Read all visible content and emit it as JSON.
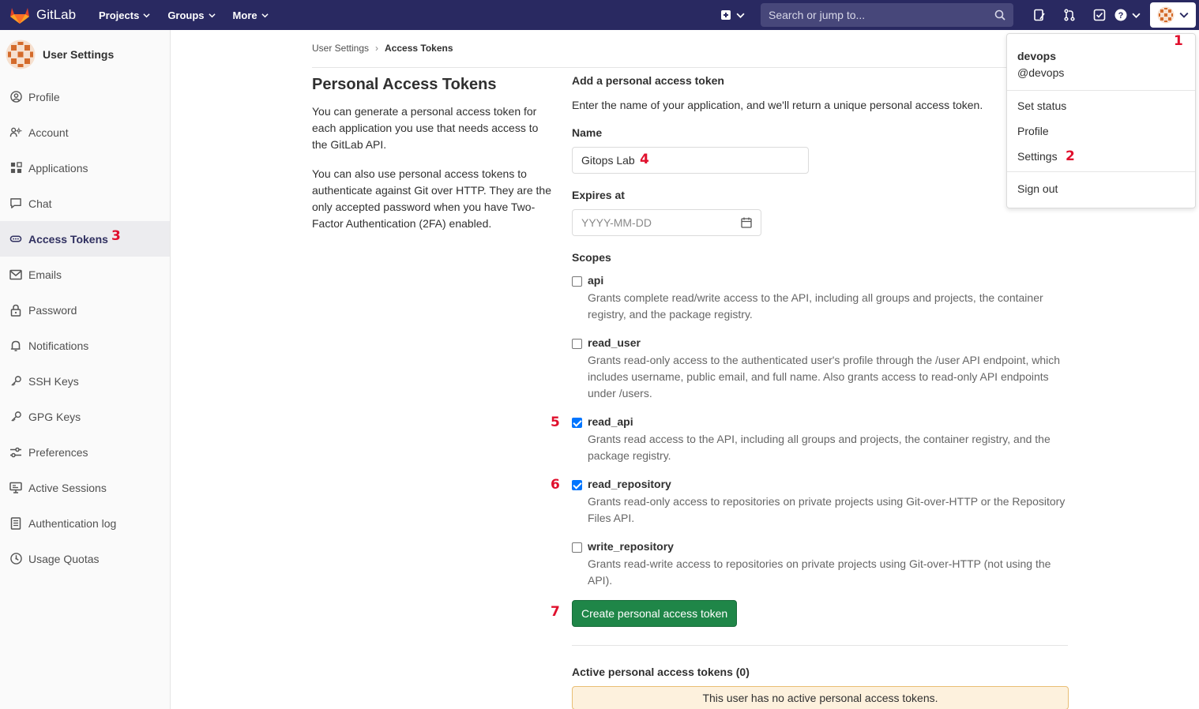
{
  "nav": {
    "brand": "GitLab",
    "items": [
      {
        "label": "Projects"
      },
      {
        "label": "Groups"
      },
      {
        "label": "More"
      }
    ],
    "search_placeholder": "Search or jump to...",
    "brand_color": "#292961"
  },
  "sidebar": {
    "title": "User Settings",
    "items": [
      {
        "label": "Profile",
        "icon": "profile-icon"
      },
      {
        "label": "Account",
        "icon": "account-icon"
      },
      {
        "label": "Applications",
        "icon": "applications-icon"
      },
      {
        "label": "Chat",
        "icon": "chat-icon"
      },
      {
        "label": "Access Tokens",
        "icon": "token-icon",
        "active": true
      },
      {
        "label": "Emails",
        "icon": "mail-icon"
      },
      {
        "label": "Password",
        "icon": "lock-icon"
      },
      {
        "label": "Notifications",
        "icon": "bell-icon"
      },
      {
        "label": "SSH Keys",
        "icon": "key-icon"
      },
      {
        "label": "GPG Keys",
        "icon": "key-icon"
      },
      {
        "label": "Preferences",
        "icon": "preferences-icon"
      },
      {
        "label": "Active Sessions",
        "icon": "monitor-icon"
      },
      {
        "label": "Authentication log",
        "icon": "log-icon"
      },
      {
        "label": "Usage Quotas",
        "icon": "quota-icon"
      }
    ]
  },
  "breadcrumb": {
    "root": "User Settings",
    "current": "Access Tokens"
  },
  "intro": {
    "title": "Personal Access Tokens",
    "para1": "You can generate a personal access token for each application you use that needs access to the GitLab API.",
    "para2": "You can also use personal access tokens to authenticate against Git over HTTP. They are the only accepted password when you have Two-Factor Authentication (2FA) enabled."
  },
  "form": {
    "title": "Add a personal access token",
    "description": "Enter the name of your application, and we'll return a unique personal access token.",
    "name_label": "Name",
    "name_value": "Gitops Lab",
    "expires_label": "Expires at",
    "expires_placeholder": "YYYY-MM-DD",
    "scopes_label": "Scopes",
    "scopes": [
      {
        "name": "api",
        "checked": false,
        "desc": "Grants complete read/write access to the API, including all groups and projects, the container registry, and the package registry."
      },
      {
        "name": "read_user",
        "checked": false,
        "desc": "Grants read-only access to the authenticated user's profile through the /user API endpoint, which includes username, public email, and full name. Also grants access to read-only API endpoints under /users."
      },
      {
        "name": "read_api",
        "checked": true,
        "desc": "Grants read access to the API, including all groups and projects, the container registry, and the package registry."
      },
      {
        "name": "read_repository",
        "checked": true,
        "desc": "Grants read-only access to repositories on private projects using Git-over-HTTP or the Repository Files API."
      },
      {
        "name": "write_repository",
        "checked": false,
        "desc": "Grants read-write access to repositories on private projects using Git-over-HTTP (not using the API)."
      }
    ],
    "create_button": "Create personal access token",
    "create_button_color": "#1f8648"
  },
  "active_tokens": {
    "title": "Active personal access tokens (0)",
    "empty_message": "This user has no active personal access tokens."
  },
  "user_menu": {
    "name": "devops",
    "handle": "@devops",
    "items": [
      "Set status",
      "Profile",
      "Settings"
    ],
    "sign_out": "Sign out"
  },
  "annotations": {
    "n1": "1",
    "n2": "2",
    "n3": "3",
    "n4": "4",
    "n5": "5",
    "n6": "6",
    "n7": "7",
    "color": "#e0102d"
  }
}
